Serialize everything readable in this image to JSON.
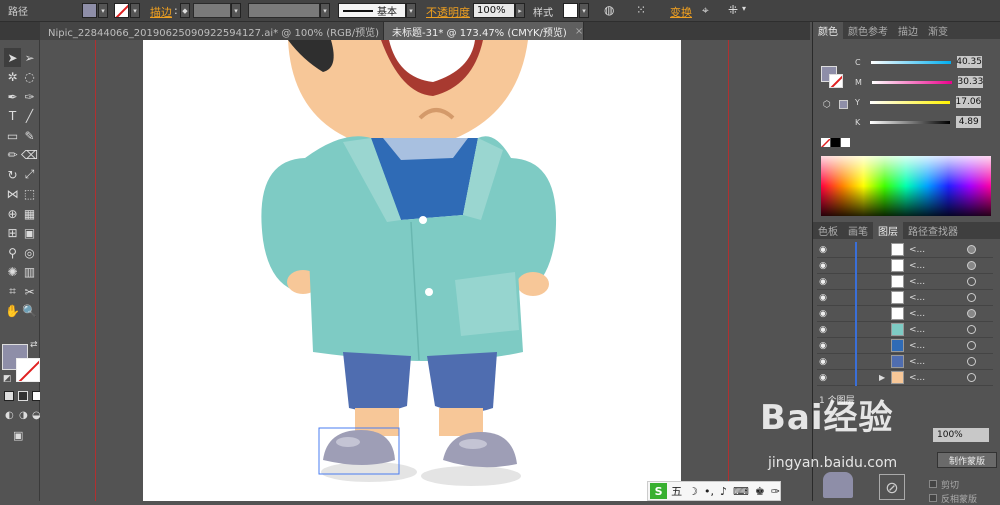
{
  "control_bar": {
    "path_label": "路径",
    "stroke_label": "描边",
    "stroke_colon": ":",
    "stroke_profile": "基本",
    "opacity_label": "不透明度",
    "opacity_value": "100%",
    "style_label": "样式",
    "transform_label": "变换"
  },
  "tabs": [
    {
      "label": "Nipic_22844066_20190625090922594127.ai* @ 100% (RGB/预览)",
      "active": false
    },
    {
      "label": "未标题-31* @ 173.47% (CMYK/预览)",
      "active": true
    }
  ],
  "color_panel": {
    "tabs": [
      "颜色",
      "颜色参考",
      "描边",
      "渐变"
    ],
    "channels": [
      {
        "name": "C",
        "value": "40.35"
      },
      {
        "name": "M",
        "value": "30.33"
      },
      {
        "name": "Y",
        "value": "17.06"
      },
      {
        "name": "K",
        "value": "4.89"
      }
    ],
    "fill_color": "#8e8ea8"
  },
  "layers_panel": {
    "tabs": [
      "色板",
      "画笔",
      "图层",
      "路径查找器"
    ],
    "rows": [
      "<...",
      "<...",
      "<...",
      "<...",
      "<...",
      "<...",
      "<...",
      "<...",
      "<..."
    ],
    "footer": "1 个图层"
  },
  "bottom_panel": {
    "opacity_value": "100%",
    "make_mask": "制作蒙版",
    "clip_label": "剪切",
    "invert_label": "反相蒙版"
  },
  "ime_bar": {
    "label": "五"
  },
  "watermark": {
    "brand": "Bai经验",
    "url": "jingyan.baidu.com"
  },
  "colors": {
    "accent_orange": "#f0a020",
    "coat": "#7ecbc4",
    "pants": "#4f6db0",
    "shoes": "#9e9eb6"
  }
}
